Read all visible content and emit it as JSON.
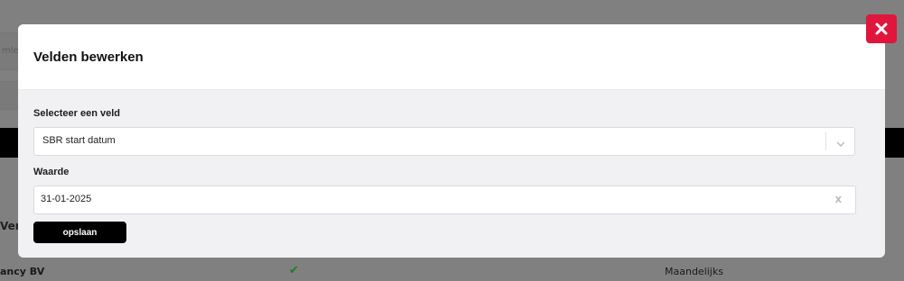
{
  "background": {
    "search_fragment": "mle",
    "column_header_fragment": "Vere",
    "row": {
      "name_fragment": "ancy BV",
      "check_icon": "check-icon",
      "frequency": "Maandelijks"
    }
  },
  "modal": {
    "title": "Velden bewerken",
    "close_icon": "close-icon",
    "field_select": {
      "label": "Selecteer een veld",
      "value": "SBR start datum",
      "chevron_icon": "chevron-down-icon"
    },
    "field_value": {
      "label": "Waarde",
      "value": "31-01-2025",
      "clear_label": "x"
    },
    "save_label": "opslaan"
  },
  "colors": {
    "overlay": "#808080",
    "close_button": "#e0163d",
    "save_button": "#000000",
    "check": "#1f7a2e"
  }
}
